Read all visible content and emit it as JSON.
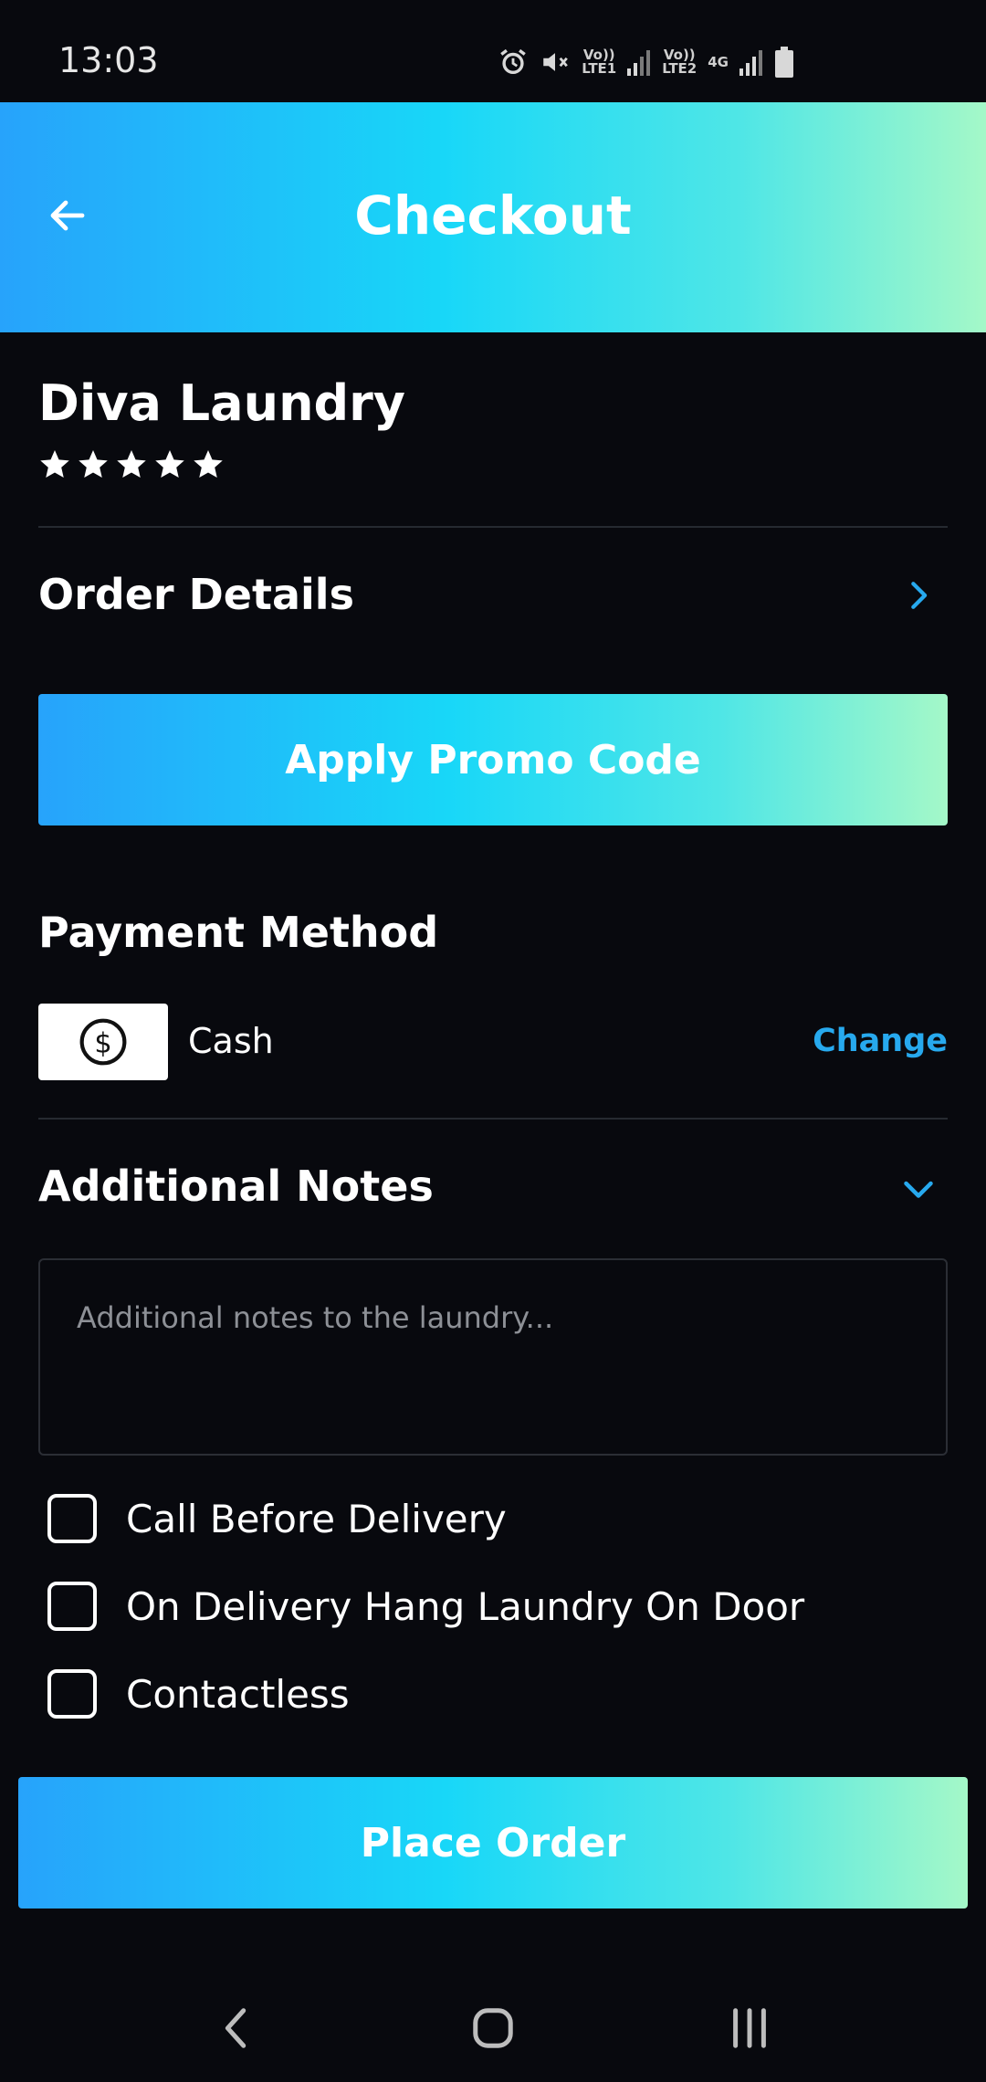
{
  "status_bar": {
    "time": "13:03",
    "sim1": "Vo))\nLTE1",
    "sim2": "Vo))\nLTE2",
    "network": "4G"
  },
  "header": {
    "title": "Checkout",
    "back_icon": "arrow-left-icon"
  },
  "store": {
    "name": "Diva Laundry",
    "rating": 5,
    "rating_max": 5
  },
  "order_details": {
    "title": "Order Details"
  },
  "promo": {
    "label": "Apply Promo Code"
  },
  "payment": {
    "title": "Payment Method",
    "method": "Cash",
    "icon": "dollar-coin-icon",
    "change_label": "Change"
  },
  "notes": {
    "title": "Additional Notes",
    "placeholder": "Additional notes to the laundry..."
  },
  "options": [
    {
      "label": "Call Before Delivery",
      "checked": false
    },
    {
      "label": "On Delivery Hang Laundry On Door",
      "checked": false
    },
    {
      "label": "Contactless",
      "checked": false
    }
  ],
  "place_order": {
    "label": "Place Order"
  },
  "colors": {
    "background": "#08090e",
    "accent_blue": "#27a9ee",
    "gradient_start": "#27a3fb",
    "gradient_end": "#a4f8c8"
  }
}
